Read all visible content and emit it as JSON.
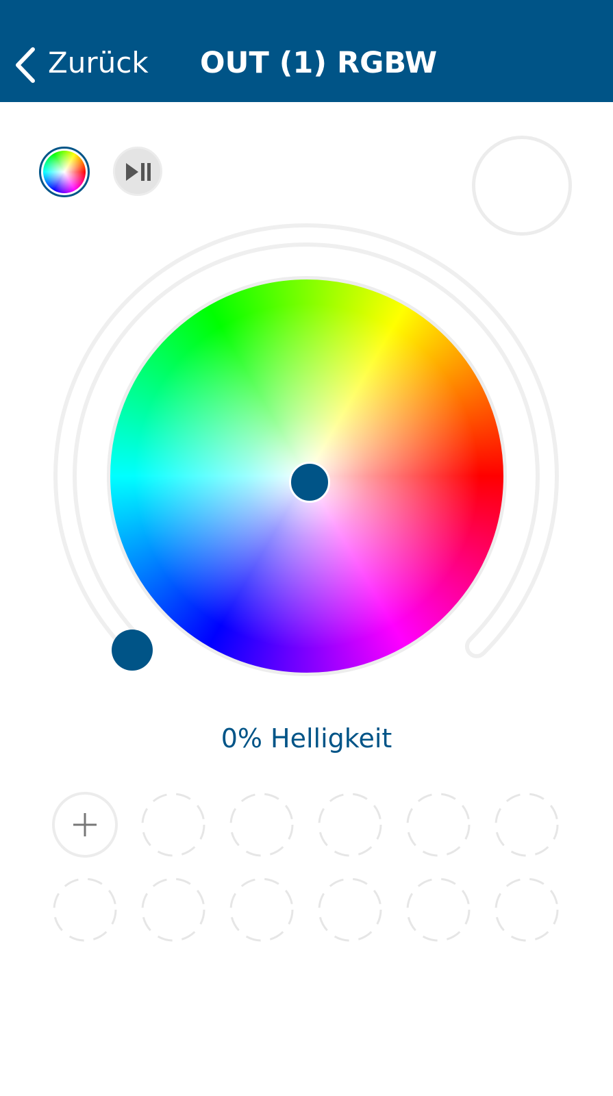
{
  "colors": {
    "accent": "#005487",
    "track": "#ececec",
    "preview_fill": "#ffffff"
  },
  "header": {
    "back_label": "Zurück",
    "title": "OUT (1) RGBW"
  },
  "modes": {
    "color_mode_icon": "color-wheel-icon",
    "program_mode_icon": "play-pause-icon",
    "active": "color"
  },
  "brightness": {
    "value_fraction": 0,
    "label": "0% Helligkeit"
  },
  "presets": {
    "add_icon": "plus-icon",
    "rows": 2,
    "slots_per_row": 6,
    "empty_slots": 11
  }
}
